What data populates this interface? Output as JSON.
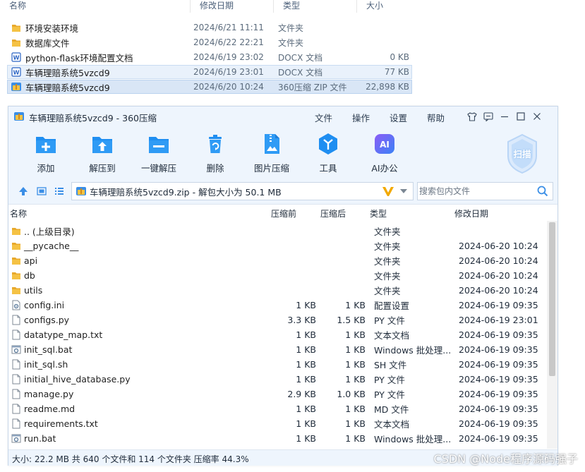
{
  "explorer": {
    "headers": {
      "name": "名称",
      "date": "修改日期",
      "type": "类型",
      "size": "大小"
    },
    "rows": [
      {
        "name": "环境安装环境",
        "date": "2024/6/21 11:11",
        "type": "文件夹",
        "size": "",
        "icon": "folder-icon"
      },
      {
        "name": "数据库文件",
        "date": "2024/6/22 22:21",
        "type": "文件夹",
        "size": "",
        "icon": "folder-icon"
      },
      {
        "name": "python-flask环境配置文档",
        "date": "2024/6/19 23:02",
        "type": "DOCX 文档",
        "size": "0 KB",
        "icon": "word-doc-icon"
      },
      {
        "name": "车辆理赔系统5vzcd9",
        "date": "2024/6/19 23:01",
        "type": "DOCX 文档",
        "size": "77 KB",
        "icon": "word-doc-icon"
      },
      {
        "name": "车辆理赔系统5vzcd9",
        "date": "2024/6/20 10:24",
        "type": "360压缩 ZIP 文件",
        "size": "22,898 KB",
        "icon": "zip-archive-icon"
      }
    ]
  },
  "window": {
    "title": "车辆理赔系统5vzcd9 - 360压缩",
    "menus": [
      "文件",
      "操作",
      "设置",
      "帮助"
    ],
    "toolbar": [
      {
        "label": "添加",
        "icon": "add-icon"
      },
      {
        "label": "解压到",
        "icon": "extract-to-icon"
      },
      {
        "label": "一键解压",
        "icon": "one-click-extract-icon"
      },
      {
        "label": "删除",
        "icon": "delete-icon"
      },
      {
        "label": "图片压缩",
        "icon": "image-compress-icon"
      },
      {
        "label": "工具",
        "icon": "tools-icon"
      },
      {
        "label": "AI办公",
        "icon": "ai-office-icon"
      }
    ],
    "scan_label": "扫描",
    "ai_badge": "AI",
    "path_text": "车辆理赔系统5vzcd9.zip - 解包大小为 50.1 MB",
    "search_placeholder": "搜索包内文件",
    "columns": {
      "name": "名称",
      "packed": "压缩前",
      "compressed": "压缩后",
      "type": "类型",
      "modified": "修改日期"
    },
    "files": [
      {
        "name": ".. (上级目录)",
        "c1": "",
        "c2": "",
        "type": "文件夹",
        "date": "",
        "icon": "folder-icon"
      },
      {
        "name": "__pycache__",
        "c1": "",
        "c2": "",
        "type": "文件夹",
        "date": "2024-06-20 10:24",
        "icon": "folder-icon"
      },
      {
        "name": "api",
        "c1": "",
        "c2": "",
        "type": "文件夹",
        "date": "2024-06-20 10:24",
        "icon": "folder-icon"
      },
      {
        "name": "db",
        "c1": "",
        "c2": "",
        "type": "文件夹",
        "date": "2024-06-20 10:24",
        "icon": "folder-icon"
      },
      {
        "name": "utils",
        "c1": "",
        "c2": "",
        "type": "文件夹",
        "date": "2024-06-20 10:24",
        "icon": "folder-icon"
      },
      {
        "name": "config.ini",
        "c1": "1 KB",
        "c2": "1 KB",
        "type": "配置设置",
        "date": "2024-06-19 09:35",
        "icon": "config-file-icon"
      },
      {
        "name": "configs.py",
        "c1": "3.3 KB",
        "c2": "1.5 KB",
        "type": "PY 文件",
        "date": "2024-06-19 23:01",
        "icon": "file-icon"
      },
      {
        "name": "datatype_map.txt",
        "c1": "1 KB",
        "c2": "1 KB",
        "type": "文本文档",
        "date": "2024-06-19 09:35",
        "icon": "file-icon"
      },
      {
        "name": "init_sql.bat",
        "c1": "1 KB",
        "c2": "1 KB",
        "type": "Windows 批处理...",
        "date": "2024-06-19 09:35",
        "icon": "batch-file-icon"
      },
      {
        "name": "init_sql.sh",
        "c1": "1 KB",
        "c2": "1 KB",
        "type": "SH 文件",
        "date": "2024-06-19 09:35",
        "icon": "file-icon"
      },
      {
        "name": "initial_hive_database.py",
        "c1": "1 KB",
        "c2": "1 KB",
        "type": "PY 文件",
        "date": "2024-06-19 09:35",
        "icon": "file-icon"
      },
      {
        "name": "manage.py",
        "c1": "2.9 KB",
        "c2": "1.0 KB",
        "type": "PY 文件",
        "date": "2024-06-19 09:35",
        "icon": "file-icon"
      },
      {
        "name": "readme.md",
        "c1": "1 KB",
        "c2": "1 KB",
        "type": "MD 文件",
        "date": "2024-06-19 09:35",
        "icon": "file-icon"
      },
      {
        "name": "requirements.txt",
        "c1": "1 KB",
        "c2": "1 KB",
        "type": "文本文档",
        "date": "2024-06-19 09:35",
        "icon": "file-icon"
      },
      {
        "name": "run.bat",
        "c1": "1 KB",
        "c2": "1 KB",
        "type": "Windows 批处理...",
        "date": "2024-06-19 09:35",
        "icon": "batch-file-icon"
      }
    ],
    "status": "大小: 22.2 MB 共 640 个文件和 114 个文件夹 压缩率 44.3%"
  },
  "watermark": "CSDN @Node程序源码强子",
  "colors": {
    "accent": "#1f8ef1",
    "folder": "#f5c244",
    "chrome": "#eef5fd"
  }
}
